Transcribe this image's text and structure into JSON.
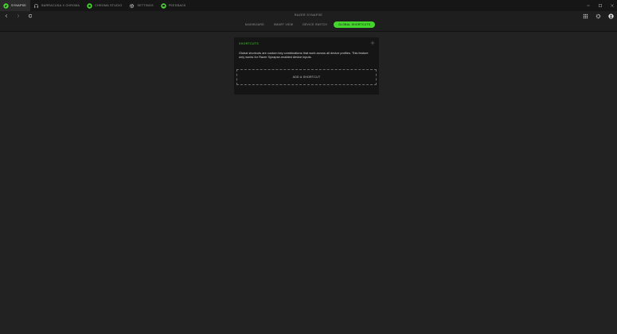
{
  "tabs": [
    {
      "label": "SYNAPSE",
      "icon": "razer-logo-icon",
      "active": true
    },
    {
      "label": "BARRACUDA X CHROMA",
      "icon": "headset-icon",
      "active": false
    },
    {
      "label": "CHROMA STUDIO",
      "icon": "chroma-icon",
      "active": false
    },
    {
      "label": "SETTINGS",
      "icon": "gear-icon",
      "active": false
    },
    {
      "label": "FEEDBACK",
      "icon": "feedback-icon",
      "active": false
    }
  ],
  "header": {
    "title": "RAZER SYNAPSE"
  },
  "subtabs": [
    {
      "label": "DASHBOARD",
      "active": false
    },
    {
      "label": "SMART VIEW",
      "active": false
    },
    {
      "label": "DEVICE SWITCH",
      "active": false
    },
    {
      "label": "GLOBAL SHORTCUTS",
      "active": true
    }
  ],
  "card": {
    "title": "SHORTCUTS",
    "description": "Global shortcuts are custom key combinations that work across all device profiles. This feature only works for Razer Synapse-enabled device inputs.",
    "add_button_label": "ADD A SHORTCUT"
  },
  "colors": {
    "accent": "#44d62c",
    "background": "#222222",
    "titlebar": "#161616",
    "card": "#151515"
  }
}
